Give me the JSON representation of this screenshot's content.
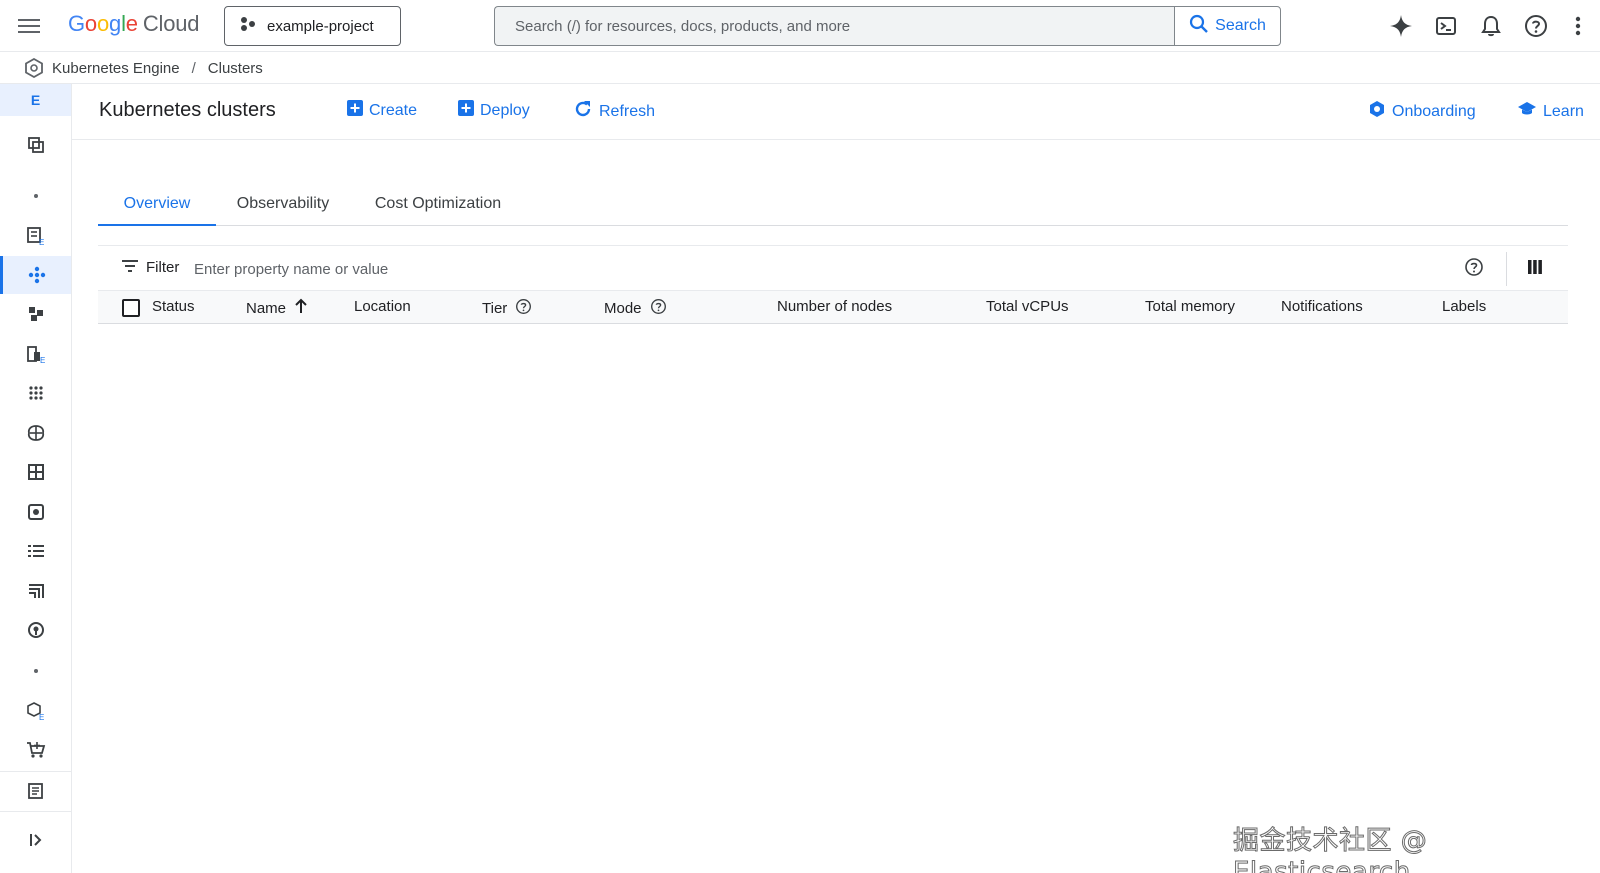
{
  "topbar": {
    "logo_letters": [
      "G",
      "o",
      "o",
      "g",
      "l",
      "e"
    ],
    "logo_cloud": "Cloud",
    "project_name": "example-project",
    "search_placeholder": "Search (/) for resources, docs, products, and more",
    "search_button": "Search"
  },
  "breadcrumb": {
    "product": "Kubernetes Engine",
    "separator": "/",
    "page": "Clusters"
  },
  "rail": {
    "top_letter": "E",
    "icons": [
      "clusters-copy-icon",
      "dot-icon",
      "workloads-icon",
      "clusters-icon",
      "applications-icon",
      "secrets-icon",
      "apps-grid-icon",
      "ai-brain-icon",
      "table-grid-icon",
      "storage-icon",
      "object-list-icon",
      "marketplace-icon",
      "security-icon",
      "dot-icon",
      "config-icon",
      "cart-icon",
      "release-notes-icon",
      "expand-icon"
    ]
  },
  "header": {
    "title": "Kubernetes clusters",
    "create_label": "Create",
    "deploy_label": "Deploy",
    "refresh_label": "Refresh",
    "onboarding_label": "Onboarding",
    "learn_label": "Learn"
  },
  "tabs": [
    {
      "label": "Overview",
      "active": true
    },
    {
      "label": "Observability",
      "active": false
    },
    {
      "label": "Cost Optimization",
      "active": false
    }
  ],
  "filter": {
    "label": "Filter",
    "placeholder": "Enter property name or value"
  },
  "table": {
    "columns": [
      "Status",
      "Name",
      "Location",
      "Tier",
      "Mode",
      "Number of nodes",
      "Total vCPUs",
      "Total memory",
      "Notifications",
      "Labels"
    ],
    "sort_column": "Name",
    "sort_direction": "ascending",
    "rows": []
  },
  "watermark": "掘金技术社区 @ Elasticsearch",
  "colors": {
    "accent": "#1a73e8",
    "text": "#202124",
    "border": "#dadce0"
  }
}
